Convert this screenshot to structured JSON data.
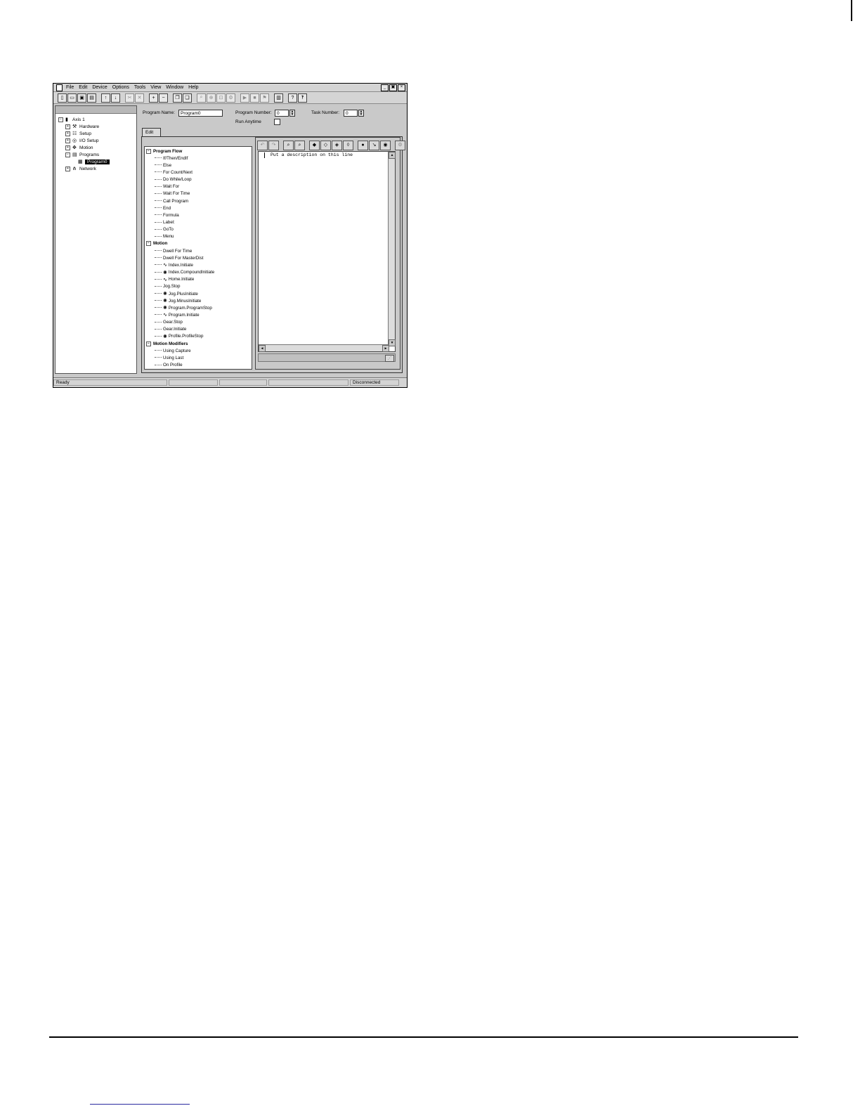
{
  "menu": [
    "File",
    "Edit",
    "Device",
    "Options",
    "Tools",
    "View",
    "Window",
    "Help"
  ],
  "window_controls": [
    "_",
    "▣",
    "×"
  ],
  "toolbar_icons": [
    "new-file-icon",
    "open-folder-icon",
    "save-icon",
    "print-icon",
    "|",
    "upload-icon",
    "download-icon",
    "|",
    "cut-icon",
    "delete-icon",
    "|",
    "add-icon",
    "remove-icon",
    "|",
    "copy-icon",
    "paste-icon",
    "|",
    "find-icon",
    "zoom-icon",
    "lock-icon",
    "compile-icon",
    "|",
    "run-icon",
    "stop-icon",
    "flag-icon",
    "|",
    "layout-icon",
    "|",
    "help-icon",
    "context-help-icon"
  ],
  "tree": {
    "items": [
      {
        "label": "Axis 1",
        "icon": "drive-icon",
        "sign": "−",
        "level": 0
      },
      {
        "label": "Hardware",
        "icon": "wrench-icon",
        "sign": "+",
        "level": 1
      },
      {
        "label": "Setup",
        "icon": "sliders-icon",
        "sign": "+",
        "level": 1
      },
      {
        "label": "I/O Setup",
        "icon": "io-icon",
        "sign": "+",
        "level": 1
      },
      {
        "label": "Motion",
        "icon": "motion-icon",
        "sign": "+",
        "level": 1
      },
      {
        "label": "Programs",
        "icon": "programs-icon",
        "sign": "−",
        "level": 1
      },
      {
        "label": "Program0",
        "icon": "program-doc-icon",
        "sign": "",
        "level": 2,
        "selected": true
      },
      {
        "label": "Network",
        "icon": "network-icon",
        "sign": "+",
        "level": 1
      }
    ]
  },
  "program": {
    "name_label": "Program Name:",
    "name_value": "Program0",
    "number_label": "Program Number:",
    "number_value": "0",
    "task_label": "Task Number:",
    "task_value": "0",
    "run_anytime_label": "Run Anytime"
  },
  "tab_label": "Edit",
  "commands": [
    {
      "label": "Program Flow",
      "group": true
    },
    {
      "label": "If/Then/EndIf"
    },
    {
      "label": "Else"
    },
    {
      "label": "For Count/Next"
    },
    {
      "label": "Do While/Loop"
    },
    {
      "label": "Wait For"
    },
    {
      "label": "Wait For Time"
    },
    {
      "label": "Call Program"
    },
    {
      "label": "End"
    },
    {
      "label": "Formula"
    },
    {
      "label": "Label:"
    },
    {
      "label": "GoTo"
    },
    {
      "label": "Menu"
    },
    {
      "label": "Motion",
      "group": true
    },
    {
      "label": "Dwell For Time"
    },
    {
      "label": "Dwell For MasterDist"
    },
    {
      "label": "Index.Initiate",
      "icon": "wave-icon"
    },
    {
      "label": "Index.CompoundInitiate",
      "icon": "gear-icon"
    },
    {
      "label": "Home.Initiate",
      "icon": "wave-icon"
    },
    {
      "label": "Jog.Stop"
    },
    {
      "label": "Jog.PlusInitiate",
      "icon": "gear-icon"
    },
    {
      "label": "Jog.MinusInitiate",
      "icon": "gear-icon"
    },
    {
      "label": "Program.ProgramStop",
      "icon": "gear-icon"
    },
    {
      "label": "Program.Initiate",
      "icon": "wave-icon"
    },
    {
      "label": "Gear.Stop"
    },
    {
      "label": "Gear.Initiate"
    },
    {
      "label": "Profile.ProfileStop",
      "icon": "gear-icon"
    },
    {
      "label": "Motion Modifiers",
      "group": true
    },
    {
      "label": "Using Capture"
    },
    {
      "label": "Using Last"
    },
    {
      "label": "On Profile"
    }
  ],
  "editor_toolbar_icons": [
    "undo-icon",
    "redo-icon",
    "|",
    "find-icon",
    "find-next-icon",
    "|",
    "bookmark-icon",
    "bookmark-next-icon",
    "bookmark-prev-icon",
    "bookmark-clear-icon",
    "|",
    "breakpoint-icon",
    "step-icon",
    "watch-icon",
    "|",
    "settings-icon"
  ],
  "editor": {
    "line": "Put a description on this line"
  },
  "status": {
    "ready": "Ready",
    "connection": "Disconnected"
  }
}
